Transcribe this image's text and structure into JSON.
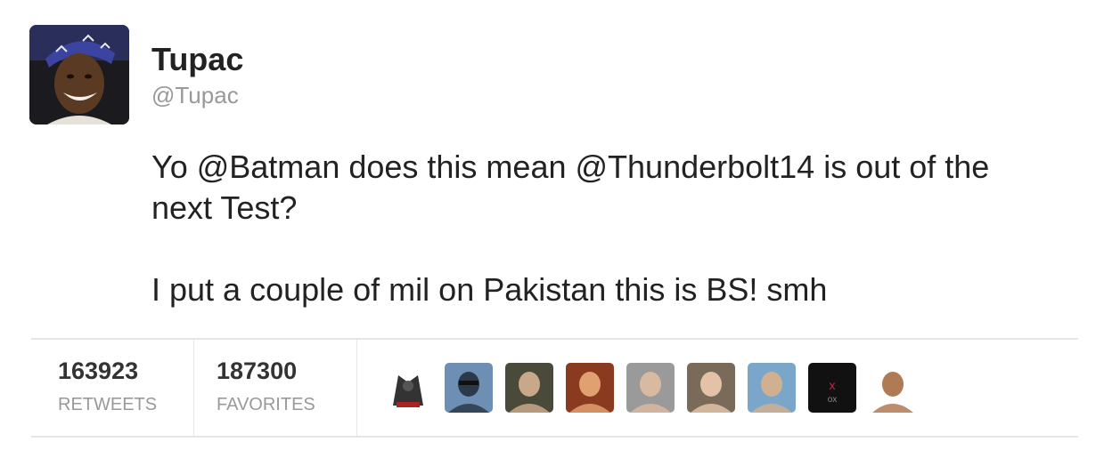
{
  "tweet": {
    "author_name": "Tupac",
    "author_handle": "@Tupac",
    "text_line1": "Yo @Batman does this mean @Thunderbolt14 is out of the next Test?",
    "text_line2": "I put a couple of mil on Pakistan this is BS! smh"
  },
  "stats": {
    "retweets_count": "163923",
    "retweets_label": "RETWEETS",
    "favorites_count": "187300",
    "favorites_label": "FAVORITES"
  },
  "favoriters": [
    {
      "icon": "robot-avatar-icon",
      "bg": "#ffffff",
      "fg": "#333333"
    },
    {
      "icon": "person-sunglasses-avatar-icon",
      "bg": "#6c8fb3",
      "fg": "#2b3a4a"
    },
    {
      "icon": "person-avatar-icon",
      "bg": "#4a4a3a",
      "fg": "#c9a88a"
    },
    {
      "icon": "person-avatar-icon",
      "bg": "#8a3a1e",
      "fg": "#e0a070"
    },
    {
      "icon": "person-avatar-icon",
      "bg": "#9a9a9a",
      "fg": "#d9b9a0"
    },
    {
      "icon": "person-avatar-icon",
      "bg": "#7a6a5a",
      "fg": "#e3c2a8"
    },
    {
      "icon": "person-avatar-icon",
      "bg": "#7aa6c9",
      "fg": "#d0b090"
    },
    {
      "icon": "logo-avatar-icon",
      "bg": "#111111",
      "fg": "#cc2244"
    },
    {
      "icon": "person-avatar-icon",
      "bg": "#ffffff",
      "fg": "#b07a55"
    }
  ],
  "colors": {
    "text": "#222222",
    "muted": "#999999",
    "divider": "#e6e6e6"
  }
}
